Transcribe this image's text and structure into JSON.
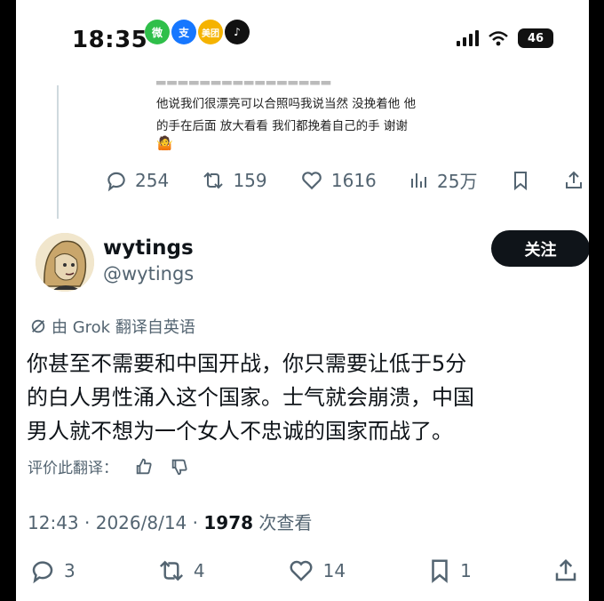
{
  "status_bar": {
    "time": "18:35",
    "apps": [
      {
        "icon": "wechat-icon",
        "glyph": "微",
        "color": "#2fbf4a"
      },
      {
        "icon": "alipay-icon",
        "glyph": "支",
        "color": "#1677ff"
      },
      {
        "icon": "meituan-icon",
        "glyph": "美团",
        "color": "#f5b300"
      },
      {
        "icon": "tiktok-icon",
        "glyph": "♪",
        "color": "#111111"
      }
    ],
    "network": "4G",
    "battery": "46"
  },
  "prev_tweet": {
    "lines": [
      "他说我们很漂亮可以合照吗我说当然 没挽着他 他",
      "的手在后面 放大看看 我们都挽着自己的手 谢谢"
    ],
    "emoji": "🤷",
    "stats": {
      "replies": "254",
      "reposts": "159",
      "likes": "1616",
      "views": "25万"
    }
  },
  "tweet": {
    "display_name": "wytings",
    "handle": "@wytings",
    "follow_label": "关注",
    "translated_label": "由 Grok 翻译自英语",
    "lines": [
      "你甚至不需要和中国开战，你只需要让低于5分",
      "的白人男性涌入这个国家。士气就会崩溃，中国",
      "男人就不想为一个女人不忠诚的国家而战了。"
    ],
    "rate_label": "评价此翻译：",
    "time": "12:43",
    "date": "2026/8/14",
    "views_count": "1978",
    "views_label": "次查看",
    "stats": {
      "replies": "3",
      "reposts": "4",
      "likes": "14",
      "bookmarks": "1"
    }
  },
  "colors": {
    "text": "#0f1419",
    "muted": "#536471",
    "border": "#cfd9de"
  }
}
